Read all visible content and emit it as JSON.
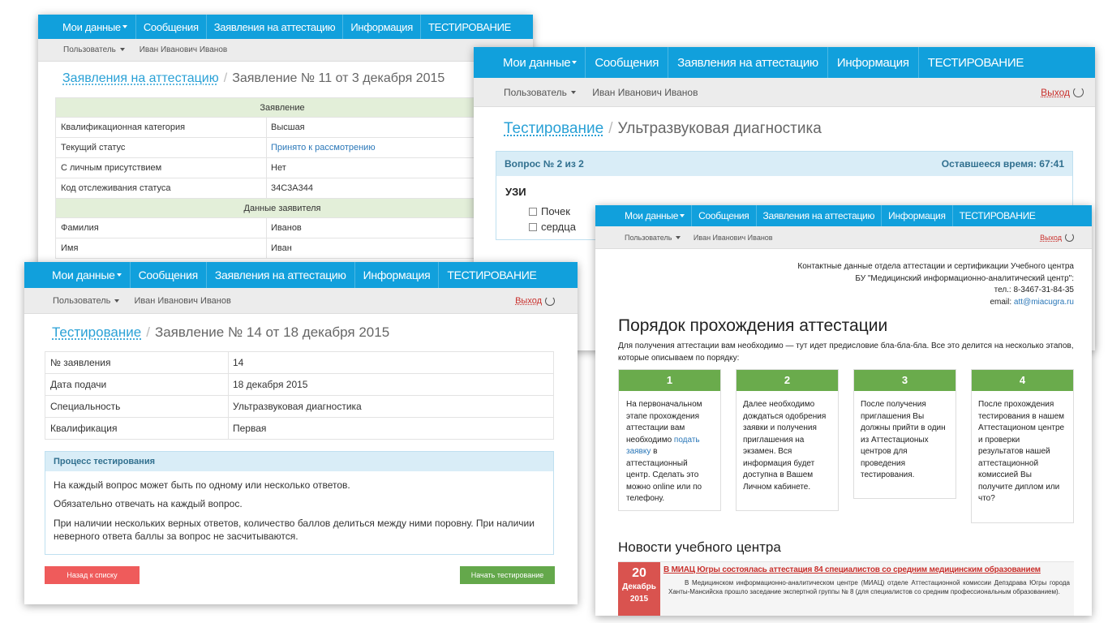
{
  "nav": {
    "my_data": "Мои данные",
    "messages": "Сообщения",
    "applications": "Заявления на аттестацию",
    "info": "Информация",
    "testing": "ТЕСТИРОВАНИЕ"
  },
  "subnav": {
    "user": "Пользователь",
    "name": "Иван Иванович Иванов",
    "logout": "Выход"
  },
  "win1": {
    "breadcrumb_link": "Заявления на аттестацию",
    "breadcrumb_current": "Заявление № 11 от 3 декабря 2015",
    "section1": "Заявление",
    "rows1": [
      {
        "label": "Квалификационная категория",
        "value": "Высшая"
      },
      {
        "label": "Текущий статус",
        "value": "Принято к рассмотрению"
      },
      {
        "label": "С личным присутствием",
        "value": "Нет"
      },
      {
        "label": "Код отслеживания статуса",
        "value": "34C3A344"
      }
    ],
    "section2": "Данные заявителя",
    "rows2": [
      {
        "label": "Фамилия",
        "value": "Иванов"
      },
      {
        "label": "Имя",
        "value": "Иван"
      }
    ]
  },
  "win2": {
    "breadcrumb_link": "Тестирование",
    "breadcrumb_current": "Ультразвуковая диагностика",
    "question": "Вопрос № 2 из 2",
    "time_left": "Оставшееся время: 67:41",
    "title": "УЗИ",
    "options": [
      "Почек",
      "сердца"
    ]
  },
  "win3": {
    "breadcrumb_link": "Тестирование",
    "breadcrumb_current": "Заявление № 14 от 18 декабря 2015",
    "rows": [
      {
        "label": "№ заявления",
        "value": "14"
      },
      {
        "label": "Дата подачи",
        "value": "18 декабря 2015"
      },
      {
        "label": "Специальность",
        "value": "Ультразвуковая диагностика"
      },
      {
        "label": "Квалификация",
        "value": "Первая"
      }
    ],
    "process_title": "Процесс тестирования",
    "p1": "На каждый вопрос может быть по одному или несколько ответов.",
    "p2": "Обязательно отвечать на каждый вопрос.",
    "p3": "При наличии нескольких верных ответов, количество баллов делиться между ними поровну. При наличии неверного ответа баллы за вопрос не засчитываются.",
    "back_btn": "Назад к списку",
    "start_btn": "Начать тестирование"
  },
  "win4": {
    "contact_line1": "Контактные данные отдела аттестации и сертификации Учебного центра",
    "contact_line2": "БУ \"Медицинский информационно-аналитический центр\":",
    "contact_phone": "тел.: 8-3467-31-84-35",
    "contact_email_label": "email:",
    "contact_email": "att@miacugra.ru",
    "heading": "Порядок прохождения аттестации",
    "intro": "Для получения аттестации вам необходимо — тут идет предисловие бла-бла-бла. Все это делится на несколько этапов, которые описываем по порядку:",
    "steps": [
      {
        "num": "1",
        "text_a": "На первоначальном этапе прохождения аттестации вам необходимо ",
        "link": "подать заявку",
        "text_b": " в аттестационный центр. Сделать это можно online или по телефону."
      },
      {
        "num": "2",
        "text_a": "Далее необходимо дождаться одобрения заявки и получения приглашения на экзамен. Вся информация будет доступна в Вашем Личном кабинете.",
        "link": "",
        "text_b": ""
      },
      {
        "num": "3",
        "text_a": "После получения приглашения Вы должны прийти в один из Аттестационых центров для проведения тестирования.",
        "link": "",
        "text_b": ""
      },
      {
        "num": "4",
        "text_a": "После прохождения тестирования в нашем Аттестационом центре и проверки результатов нашей аттестационной комиссией Вы получите диплом или что?",
        "link": "",
        "text_b": ""
      }
    ],
    "news_heading": "Новости учебного центра",
    "news_day": "20",
    "news_month": "Декабрь",
    "news_year": "2015",
    "news_title": "В МИАЦ Югры состоялась аттестация 84 специалистов со средним медицинским образованием",
    "news_text": "В Медицинском информационно-аналитическом центре (МИАЦ) отделе Аттестационной комиссии Депздрава Югры города Ханты-Мансийска прошло заседание экспертной группы № 8 (для специалистов со средним профессиональным образованием)."
  }
}
